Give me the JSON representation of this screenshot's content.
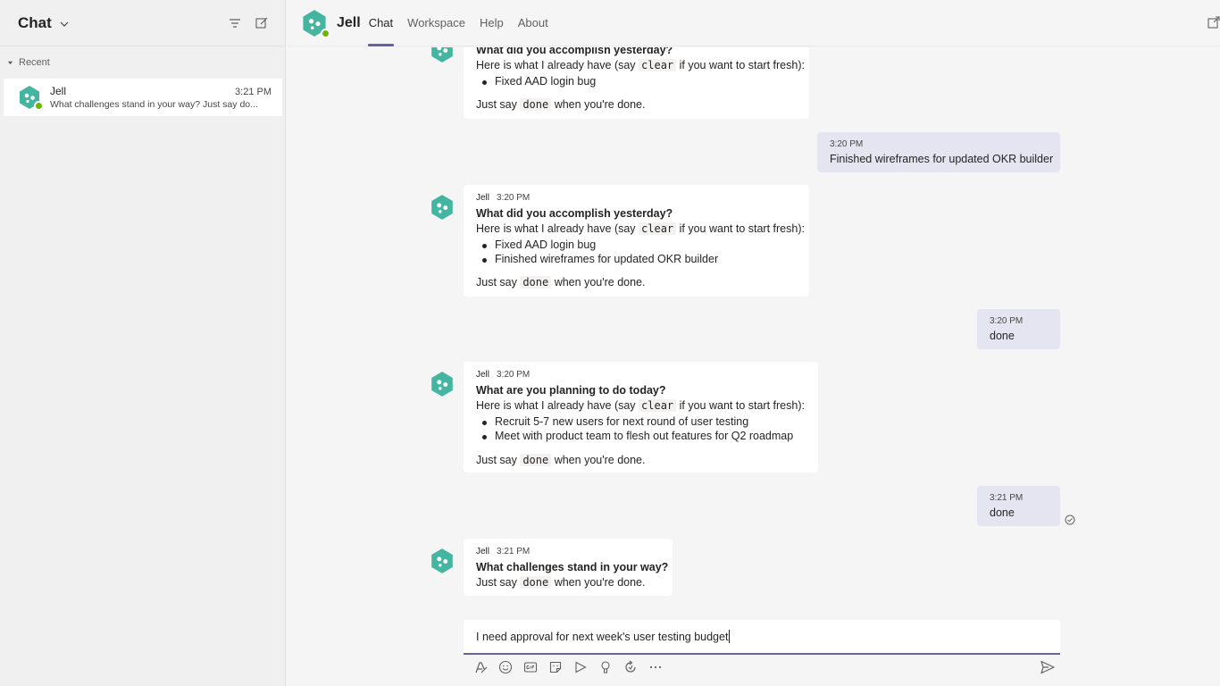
{
  "left_pane": {
    "title": "Chat",
    "section_label": "Recent",
    "chat_item": {
      "name": "Jell",
      "time": "3:21 PM",
      "preview": "What challenges stand in your way? Just say do..."
    }
  },
  "top_bar": {
    "bot_name": "Jell",
    "tabs": [
      "Chat",
      "Workspace",
      "Help",
      "About"
    ],
    "active_tab": "Chat"
  },
  "messages": {
    "m1": {
      "question": "What did you accomplish yesterday?",
      "intro_pre": "Here is what I already have (say ",
      "intro_code": "clear",
      "intro_post": " if you want to start fresh):",
      "items": [
        "Fixed AAD login bug"
      ],
      "done_pre": "Just say ",
      "done_code": "done",
      "done_post": " when you're done."
    },
    "r1": {
      "time": "3:20 PM",
      "text": "Finished wireframes for updated OKR builder"
    },
    "m2": {
      "sender": "Jell",
      "time": "3:20 PM",
      "question": "What did you accomplish yesterday?",
      "intro_pre": "Here is what I already have (say ",
      "intro_code": "clear",
      "intro_post": " if you want to start fresh):",
      "items": [
        "Fixed AAD login bug",
        "Finished wireframes for updated OKR builder"
      ],
      "done_pre": "Just say ",
      "done_code": "done",
      "done_post": " when you're done."
    },
    "r2": {
      "time": "3:20 PM",
      "text": "done"
    },
    "m3": {
      "sender": "Jell",
      "time": "3:20 PM",
      "question": "What are you planning to do today?",
      "intro_pre": "Here is what I already have (say ",
      "intro_code": "clear",
      "intro_post": " if you want to start fresh):",
      "items": [
        "Recruit 5-7 new users for next round of user testing",
        "Meet with product team to flesh out features for Q2 roadmap"
      ],
      "done_pre": "Just say ",
      "done_code": "done",
      "done_post": " when you're done."
    },
    "r3": {
      "time": "3:21 PM",
      "text": "done"
    },
    "m4": {
      "sender": "Jell",
      "time": "3:21 PM",
      "question": "What challenges stand in your way?",
      "done_pre": "Just say ",
      "done_code": "done",
      "done_post": " when you're done."
    }
  },
  "compose": {
    "value": "I need approval for next week's user testing budget"
  },
  "colors": {
    "accent": "#6264a7",
    "bot_avatar": "#43b5a0",
    "presence": "#6bb700",
    "my_bubble": "#e5e5f1"
  },
  "icons": {
    "compose_toolbar": [
      "format-icon",
      "emoji-icon",
      "gif-icon",
      "sticker-icon",
      "meet-now-icon",
      "praise-icon",
      "loop-icon",
      "more-options-icon"
    ]
  }
}
